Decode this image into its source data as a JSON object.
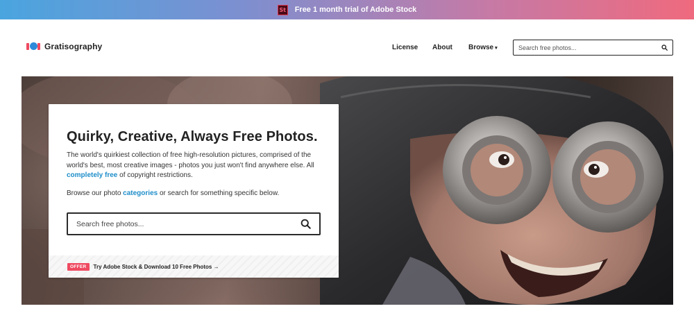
{
  "promo": {
    "logo_text": "St",
    "text": "Free 1 month trial of Adobe Stock"
  },
  "header": {
    "brand_name": "Gratisography",
    "nav": {
      "license": "License",
      "about": "About",
      "browse": "Browse",
      "browse_caret": "▾"
    },
    "search": {
      "placeholder": "Search free photos..."
    }
  },
  "hero": {
    "title": "Quirky, Creative, Always Free Photos.",
    "description_1": "The world's quirkiest collection of free high-resolution pictures, comprised of the world's best, most creative images - photos you just won't find anywhere else. All ",
    "description_link": "completely free",
    "description_2": " of copyright restrictions.",
    "browse_1": "Browse our photo ",
    "browse_link": "categories",
    "browse_2": " or search for something specific below.",
    "search": {
      "placeholder": "Search free photos..."
    },
    "offer": {
      "badge": "OFFER",
      "link": "Try Adobe Stock & Download 10 Free Photos →"
    }
  },
  "colors": {
    "accent_blue": "#1e8ec9",
    "accent_red": "#ef4a61",
    "promo_gradient_start": "#4aa5df",
    "promo_gradient_end": "#ef6a7e"
  }
}
